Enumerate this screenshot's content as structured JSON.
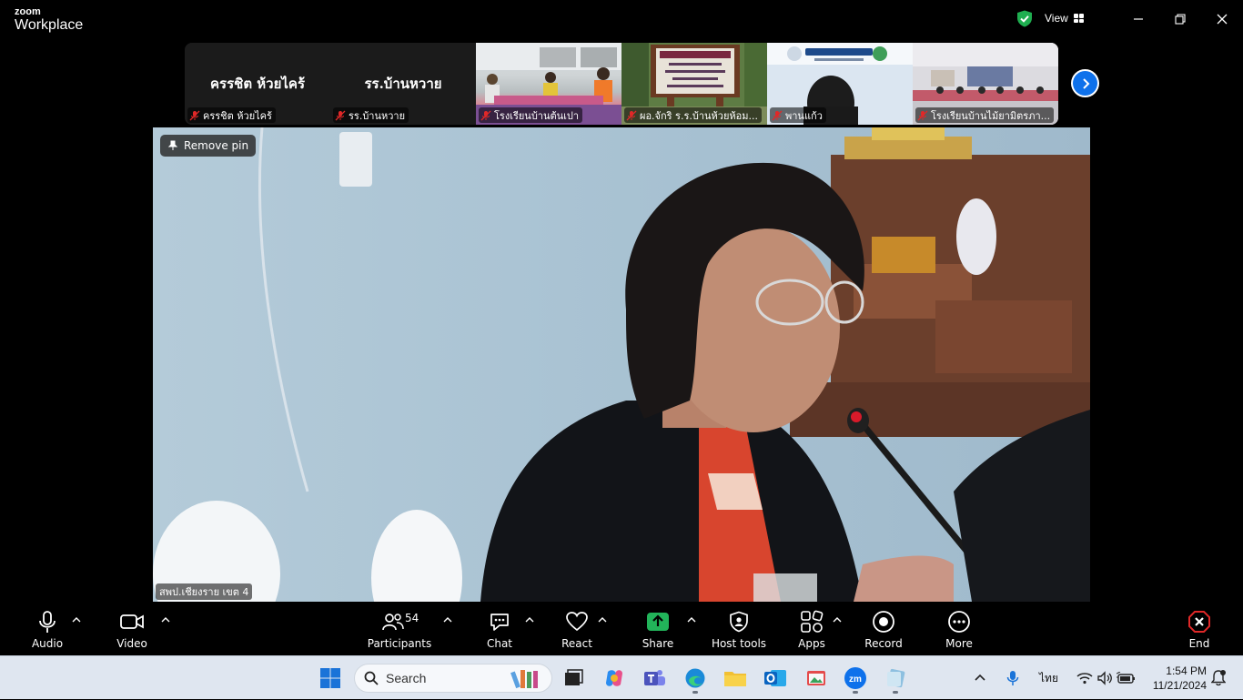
{
  "titlebar": {
    "logo_top": "zoom",
    "logo_bottom": "Workplace",
    "view_label": "View"
  },
  "thumbnails": [
    {
      "title": "ครรชิต ห้วยไคร้",
      "caption": "ครรชิต ห้วยไคร้"
    },
    {
      "title": "รร.บ้านหวาย",
      "caption": "รร.บ้านหวาย"
    },
    {
      "caption": "โรงเรียนบ้านต้นเปา"
    },
    {
      "caption": "ผอ.จักริ ร.ร.บ้านห้วยห้อม..."
    },
    {
      "caption": "พานแก้ว"
    },
    {
      "caption": "โรงเรียนบ้านไม้ยามิตรภา..."
    }
  ],
  "main_video": {
    "remove_pin_label": "Remove pin",
    "name_tag": "สพป.เชียงราย เขต 4"
  },
  "controls": {
    "audio": "Audio",
    "video": "Video",
    "participants": "Participants",
    "participants_count": "54",
    "chat": "Chat",
    "react": "React",
    "share": "Share",
    "host_tools": "Host tools",
    "apps": "Apps",
    "record": "Record",
    "more": "More",
    "end": "End"
  },
  "taskbar": {
    "search_placeholder": "Search",
    "language": "ไทย",
    "time": "1:54 PM",
    "date": "11/21/2024"
  },
  "colors": {
    "zoom_blue": "#0e71eb",
    "share_green": "#22b45a",
    "end_red": "#e02828",
    "secure_green": "#1fae50"
  }
}
